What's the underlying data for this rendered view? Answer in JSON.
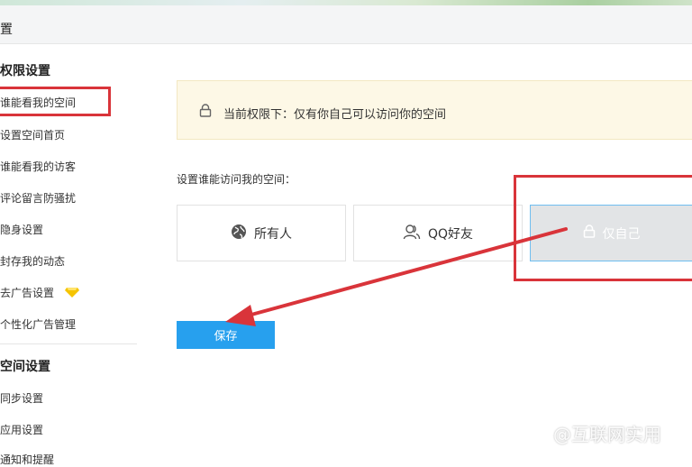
{
  "header": {
    "title": "置"
  },
  "sidebar": {
    "section1_title": "权限设置",
    "section1_items": [
      {
        "label": "谁能看我的空间"
      },
      {
        "label": "设置空间首页"
      },
      {
        "label": "谁能看我的访客"
      },
      {
        "label": "评论留言防骚扰"
      },
      {
        "label": "隐身设置"
      },
      {
        "label": "封存我的动态"
      },
      {
        "label": "去广告设置"
      },
      {
        "label": "个性化广告管理"
      }
    ],
    "section2_title": "空间设置",
    "section2_items": [
      {
        "label": "同步设置"
      },
      {
        "label": "应用设置"
      },
      {
        "label": "通知和提醒"
      }
    ]
  },
  "notice": {
    "text": "当前权限下：仅有你自己可以访问你的空间",
    "icon": "lock-icon"
  },
  "access": {
    "prompt": "设置谁能访问我的空间：",
    "options": [
      {
        "label": "所有人",
        "icon": "globe-icon",
        "selected": false
      },
      {
        "label": "QQ好友",
        "icon": "friends-icon",
        "selected": false
      },
      {
        "label": "仅自己",
        "icon": "lock-icon",
        "selected": true
      }
    ]
  },
  "save_label": "保存",
  "watermark": "@互联网实用",
  "colors": {
    "accent": "#27a0ee",
    "highlight_red": "#d9343a",
    "notice_bg": "#fdf8e6",
    "premium_icon": "#f5c400"
  }
}
